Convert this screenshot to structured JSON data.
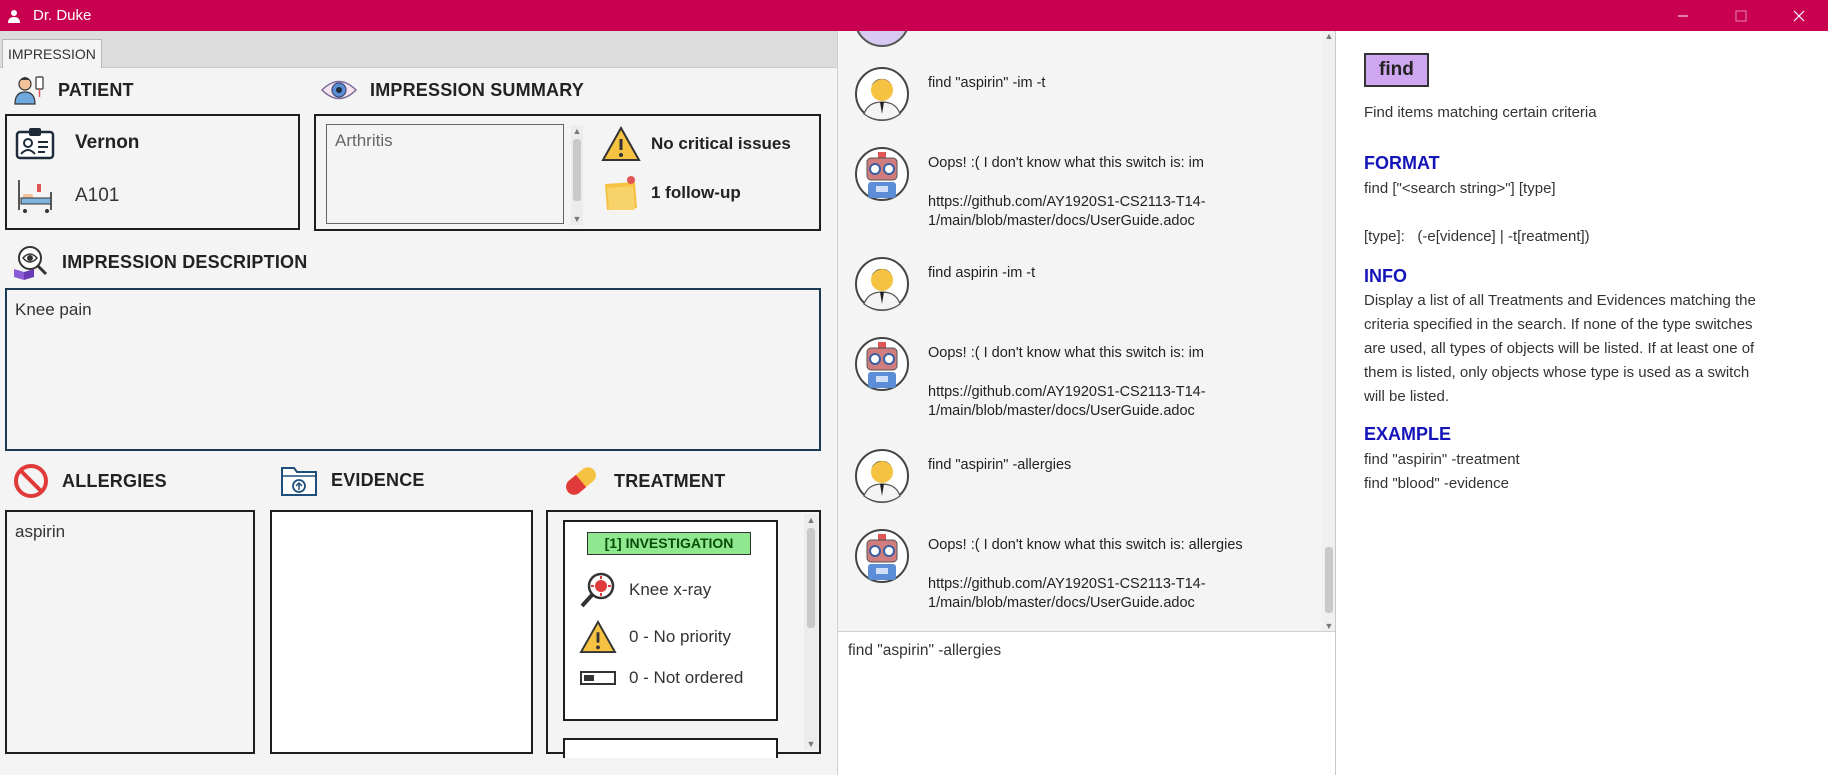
{
  "window": {
    "title": "Dr. Duke"
  },
  "tabs": [
    {
      "label": "IMPRESSION"
    }
  ],
  "patient": {
    "heading": "PATIENT",
    "name": "Vernon",
    "bed": "A101"
  },
  "summary": {
    "heading": "IMPRESSION SUMMARY",
    "text": "Arthritis",
    "critical": "No critical issues",
    "followup": "1 follow-up"
  },
  "description": {
    "heading": "IMPRESSION DESCRIPTION",
    "text": "Knee pain"
  },
  "allergies": {
    "heading": "ALLERGIES",
    "items": [
      "aspirin"
    ]
  },
  "evidence": {
    "heading": "EVIDENCE"
  },
  "treatment": {
    "heading": "TREATMENT",
    "card": {
      "badge": "[1] INVESTIGATION",
      "name": "Knee x-ray",
      "priority": "0 - No priority",
      "status": "0 - Not ordered"
    }
  },
  "chat": [
    {
      "sender": "user",
      "text": "find \"aspirin\" -im -t"
    },
    {
      "sender": "bot",
      "text": "Oops! :( I don't know what this switch is: im",
      "link": "https://github.com/AY1920S1-CS2113-T14-1/main/blob/master/docs/UserGuide.adoc"
    },
    {
      "sender": "user",
      "text": "find aspirin -im -t"
    },
    {
      "sender": "bot",
      "text": "Oops! :( I don't know what this switch is: im",
      "link": "https://github.com/AY1920S1-CS2113-T14-1/main/blob/master/docs/UserGuide.adoc"
    },
    {
      "sender": "user",
      "text": "find \"aspirin\" -allergies"
    },
    {
      "sender": "bot",
      "text": "Oops! :( I don't know what this switch is: allergies",
      "link": "https://github.com/AY1920S1-CS2113-T14-1/main/blob/master/docs/UserGuide.adoc"
    }
  ],
  "input": {
    "value": "find \"aspirin\" -allergies"
  },
  "help": {
    "command": "find",
    "summary": "Find items matching certain criteria",
    "format_heading": "FORMAT",
    "format_line": "find [\"<search string>\"] [type]",
    "type_line": "[type]:   (-e[vidence] | -t[reatment])",
    "info_heading": "INFO",
    "info_text": "Display a list of all Treatments and Evidences matching the criteria specified in the search. If none of the type switches are used, all types of objects will be listed. If at least one of them is listed, only objects whose type is used as a switch will be listed.",
    "example_heading": "EXAMPLE",
    "examples": [
      "find \"aspirin\" -treatment",
      "find \"blood\" -evidence"
    ]
  },
  "colors": {
    "titlebar": "#c8004f",
    "command_badge": "#cfa6f0",
    "investigation_badge": "#8fe88f",
    "help_heading": "#1414b8"
  }
}
